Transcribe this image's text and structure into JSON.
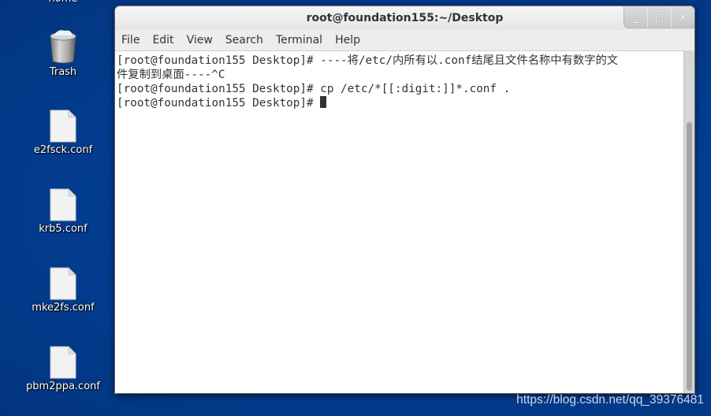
{
  "desktop": {
    "icons": [
      {
        "label": "home",
        "type": "folder"
      },
      {
        "label": "Trash",
        "type": "trash"
      },
      {
        "label": "e2fsck.conf",
        "type": "file"
      },
      {
        "label": "krb5.conf",
        "type": "file"
      },
      {
        "label": "mke2fs.conf",
        "type": "file"
      },
      {
        "label": "pbm2ppa.conf",
        "type": "file"
      }
    ]
  },
  "window": {
    "title": "root@foundation155:~/Desktop",
    "buttons": {
      "minimize": "_",
      "maximize": "□",
      "close": "✕"
    },
    "menu": [
      "File",
      "Edit",
      "View",
      "Search",
      "Terminal",
      "Help"
    ]
  },
  "terminal": {
    "lines": [
      "[root@foundation155 Desktop]# ----将/etc/内所有以.conf结尾且文件名称中有数字的文",
      "件复制到桌面----^C",
      "[root@foundation155 Desktop]# cp /etc/*[[:digit:]]*.conf .",
      "[root@foundation155 Desktop]# "
    ]
  },
  "watermark": "https://blog.csdn.net/qq_39376481"
}
